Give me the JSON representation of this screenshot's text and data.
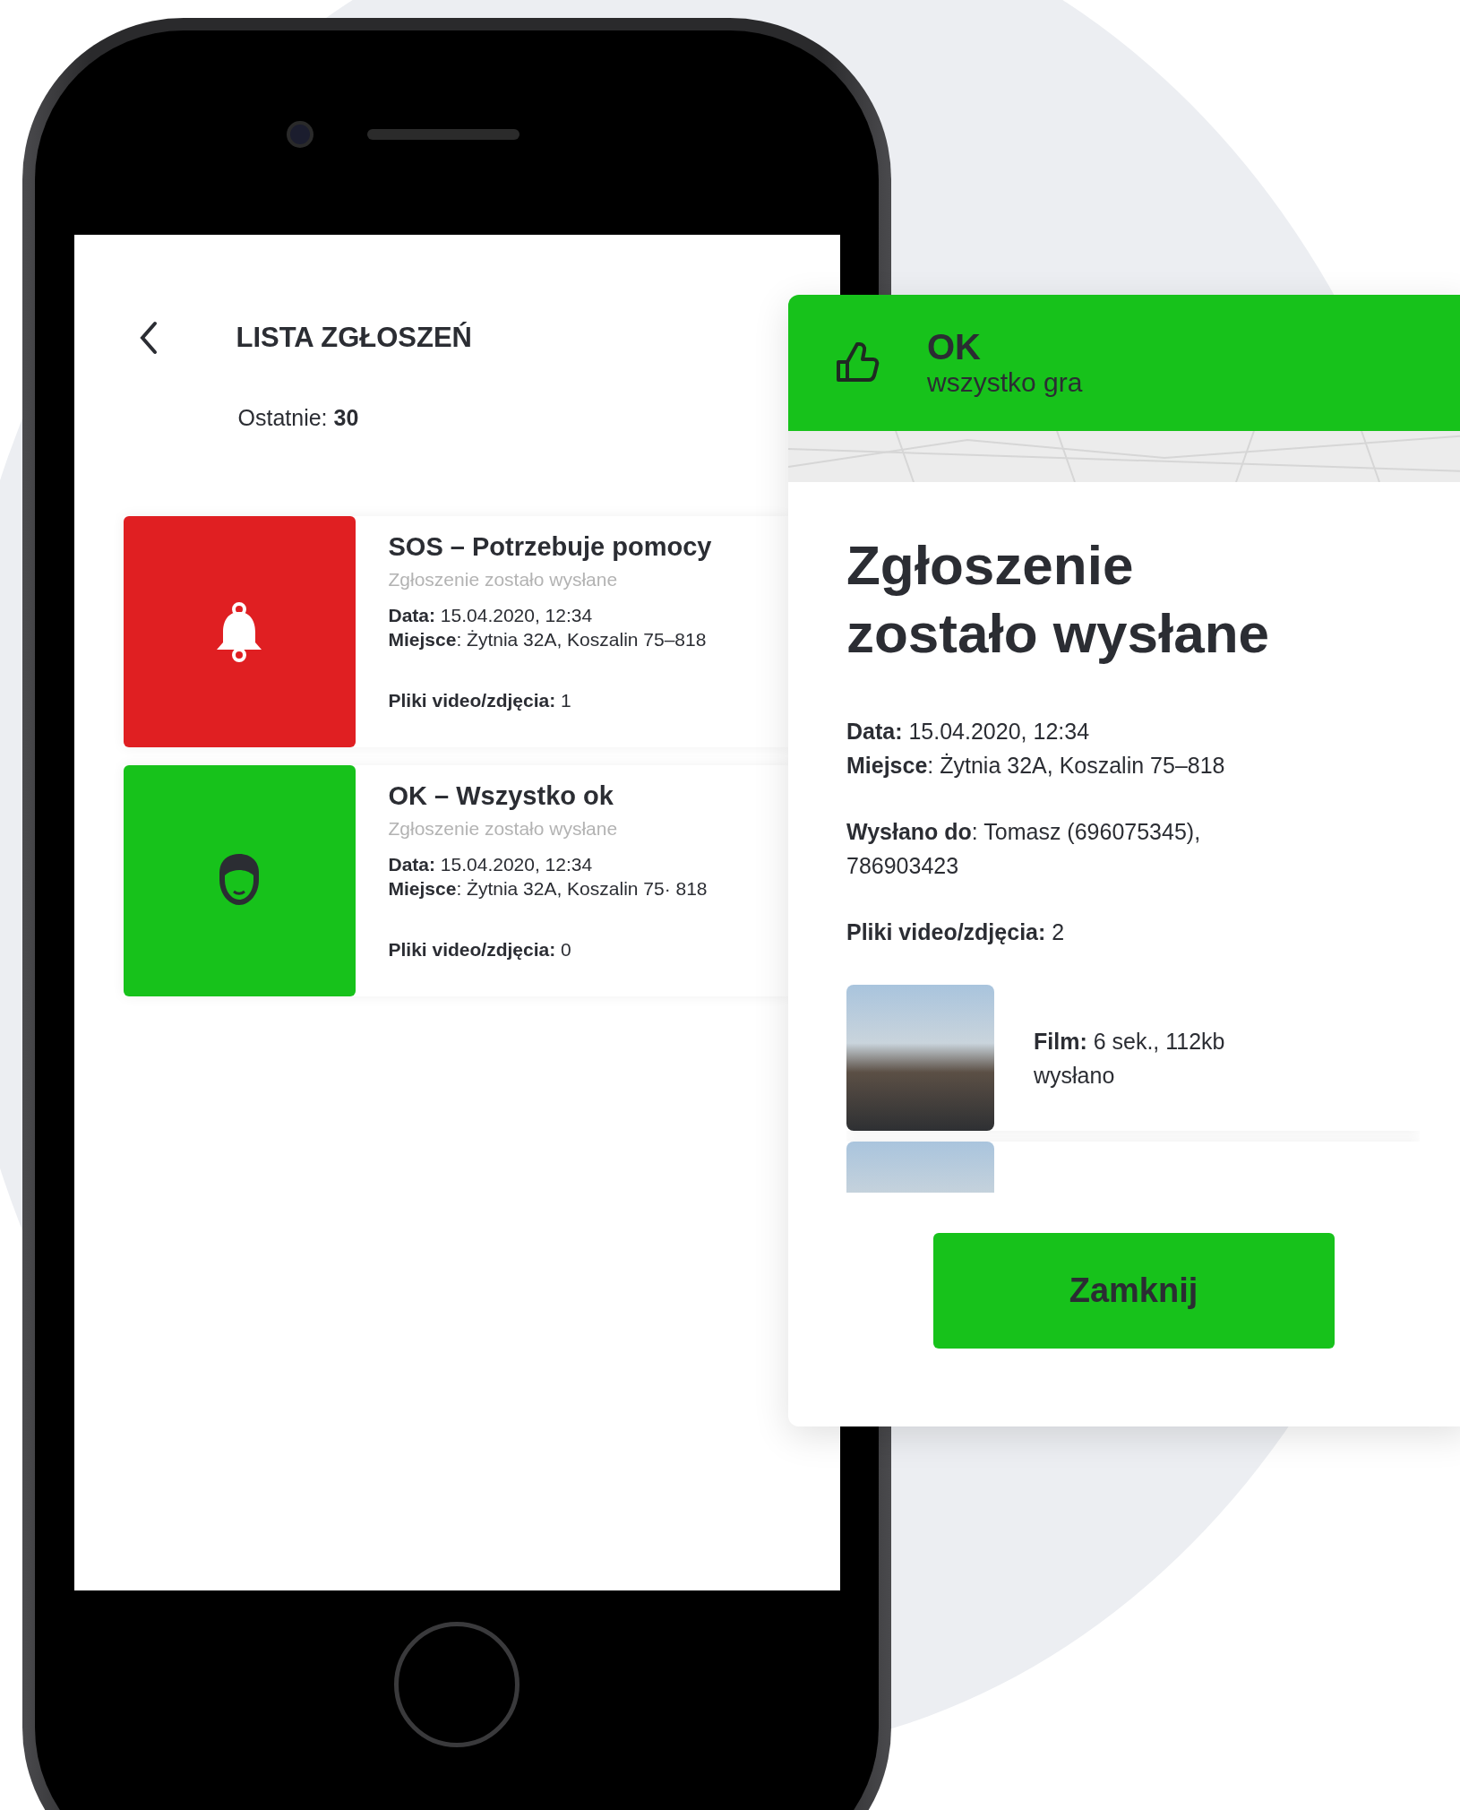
{
  "list_screen": {
    "title": "LISTA ZGŁOSZEŃ",
    "recent": "Ostatnie: **30**",
    "reports": [
      {
        "kind": "sos",
        "color": "#e01f22",
        "title": "SOS – Potrzebuje pomocy",
        "status": "Zgłoszenie zostało wysłane",
        "date": "**Data:** 15.04.2020, 12:34",
        "place": "**Miejsce**: Żytnia 32A, Koszalin 75–818",
        "files": "**Pliki video/zdjęcia:** 1"
      },
      {
        "kind": "ok",
        "color": "#17c21b",
        "title": "OK – Wszystko ok",
        "status": "Zgłoszenie zostało wysłane",
        "date": "**Data:** 15.04.2020, 12:34",
        "place": "**Miejsce**: Żytnia 32A, Koszalin 75· 818",
        "files": "**Pliki video/zdjęcia:** 0"
      }
    ]
  },
  "detail_card": {
    "status_title": "OK",
    "status_subtitle": "wszystko gra",
    "heading": "Zgłoszenie zostało wysłane",
    "date": "**Data:** 15.04.2020, 12:34",
    "place": "**Miejsce**: Żytnia 32A, Koszalin 75–818",
    "sent_to": "**Wysłano do**: Tomasz (696075345), 786903423",
    "files_count": "**Pliki video/zdjęcia:** 2",
    "files": [
      {
        "kind": "video",
        "info": "**Film:** 6 sek., 112kb",
        "state": "wysłano"
      },
      {
        "kind": "video"
      }
    ],
    "close_button": "Zamknij"
  }
}
